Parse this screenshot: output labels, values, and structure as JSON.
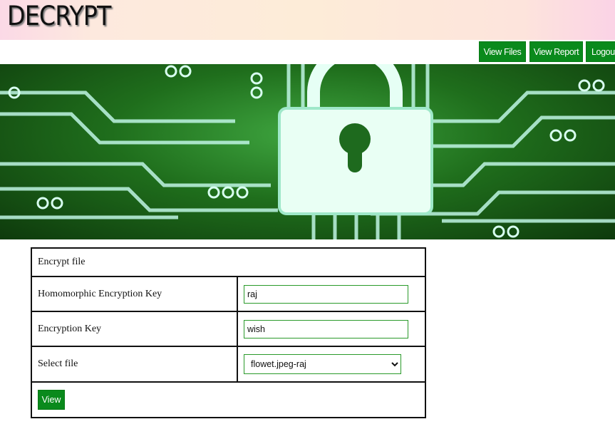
{
  "header": {
    "title": "DECRYPT"
  },
  "nav": {
    "view_files": "View Files",
    "view_report": "View Report",
    "logout": "Logout"
  },
  "form": {
    "heading": "Encrypt file",
    "homomorphic_label": "Homomorphic Encryption Key",
    "homomorphic_value": "raj",
    "encryption_label": "Encryption Key",
    "encryption_value": "wish",
    "file_label": "Select file",
    "file_selected": "flowet.jpeg-raj",
    "submit": "View"
  },
  "colors": {
    "accent": "#0a8a1c"
  }
}
